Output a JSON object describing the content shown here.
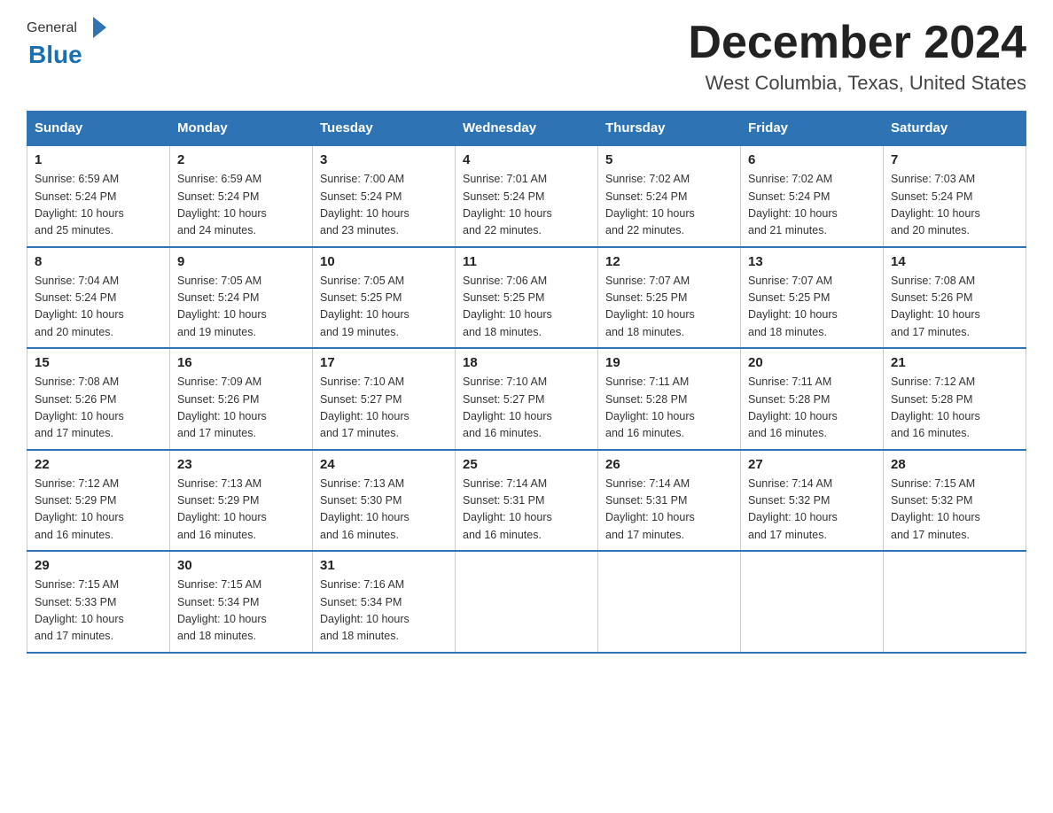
{
  "logo": {
    "general": "General",
    "blue": "Blue"
  },
  "title": "December 2024",
  "location": "West Columbia, Texas, United States",
  "weekdays": [
    "Sunday",
    "Monday",
    "Tuesday",
    "Wednesday",
    "Thursday",
    "Friday",
    "Saturday"
  ],
  "weeks": [
    [
      {
        "day": "1",
        "sunrise": "6:59 AM",
        "sunset": "5:24 PM",
        "daylight": "10 hours and 25 minutes."
      },
      {
        "day": "2",
        "sunrise": "6:59 AM",
        "sunset": "5:24 PM",
        "daylight": "10 hours and 24 minutes."
      },
      {
        "day": "3",
        "sunrise": "7:00 AM",
        "sunset": "5:24 PM",
        "daylight": "10 hours and 23 minutes."
      },
      {
        "day": "4",
        "sunrise": "7:01 AM",
        "sunset": "5:24 PM",
        "daylight": "10 hours and 22 minutes."
      },
      {
        "day": "5",
        "sunrise": "7:02 AM",
        "sunset": "5:24 PM",
        "daylight": "10 hours and 22 minutes."
      },
      {
        "day": "6",
        "sunrise": "7:02 AM",
        "sunset": "5:24 PM",
        "daylight": "10 hours and 21 minutes."
      },
      {
        "day": "7",
        "sunrise": "7:03 AM",
        "sunset": "5:24 PM",
        "daylight": "10 hours and 20 minutes."
      }
    ],
    [
      {
        "day": "8",
        "sunrise": "7:04 AM",
        "sunset": "5:24 PM",
        "daylight": "10 hours and 20 minutes."
      },
      {
        "day": "9",
        "sunrise": "7:05 AM",
        "sunset": "5:24 PM",
        "daylight": "10 hours and 19 minutes."
      },
      {
        "day": "10",
        "sunrise": "7:05 AM",
        "sunset": "5:25 PM",
        "daylight": "10 hours and 19 minutes."
      },
      {
        "day": "11",
        "sunrise": "7:06 AM",
        "sunset": "5:25 PM",
        "daylight": "10 hours and 18 minutes."
      },
      {
        "day": "12",
        "sunrise": "7:07 AM",
        "sunset": "5:25 PM",
        "daylight": "10 hours and 18 minutes."
      },
      {
        "day": "13",
        "sunrise": "7:07 AM",
        "sunset": "5:25 PM",
        "daylight": "10 hours and 18 minutes."
      },
      {
        "day": "14",
        "sunrise": "7:08 AM",
        "sunset": "5:26 PM",
        "daylight": "10 hours and 17 minutes."
      }
    ],
    [
      {
        "day": "15",
        "sunrise": "7:08 AM",
        "sunset": "5:26 PM",
        "daylight": "10 hours and 17 minutes."
      },
      {
        "day": "16",
        "sunrise": "7:09 AM",
        "sunset": "5:26 PM",
        "daylight": "10 hours and 17 minutes."
      },
      {
        "day": "17",
        "sunrise": "7:10 AM",
        "sunset": "5:27 PM",
        "daylight": "10 hours and 17 minutes."
      },
      {
        "day": "18",
        "sunrise": "7:10 AM",
        "sunset": "5:27 PM",
        "daylight": "10 hours and 16 minutes."
      },
      {
        "day": "19",
        "sunrise": "7:11 AM",
        "sunset": "5:28 PM",
        "daylight": "10 hours and 16 minutes."
      },
      {
        "day": "20",
        "sunrise": "7:11 AM",
        "sunset": "5:28 PM",
        "daylight": "10 hours and 16 minutes."
      },
      {
        "day": "21",
        "sunrise": "7:12 AM",
        "sunset": "5:28 PM",
        "daylight": "10 hours and 16 minutes."
      }
    ],
    [
      {
        "day": "22",
        "sunrise": "7:12 AM",
        "sunset": "5:29 PM",
        "daylight": "10 hours and 16 minutes."
      },
      {
        "day": "23",
        "sunrise": "7:13 AM",
        "sunset": "5:29 PM",
        "daylight": "10 hours and 16 minutes."
      },
      {
        "day": "24",
        "sunrise": "7:13 AM",
        "sunset": "5:30 PM",
        "daylight": "10 hours and 16 minutes."
      },
      {
        "day": "25",
        "sunrise": "7:14 AM",
        "sunset": "5:31 PM",
        "daylight": "10 hours and 16 minutes."
      },
      {
        "day": "26",
        "sunrise": "7:14 AM",
        "sunset": "5:31 PM",
        "daylight": "10 hours and 17 minutes."
      },
      {
        "day": "27",
        "sunrise": "7:14 AM",
        "sunset": "5:32 PM",
        "daylight": "10 hours and 17 minutes."
      },
      {
        "day": "28",
        "sunrise": "7:15 AM",
        "sunset": "5:32 PM",
        "daylight": "10 hours and 17 minutes."
      }
    ],
    [
      {
        "day": "29",
        "sunrise": "7:15 AM",
        "sunset": "5:33 PM",
        "daylight": "10 hours and 17 minutes."
      },
      {
        "day": "30",
        "sunrise": "7:15 AM",
        "sunset": "5:34 PM",
        "daylight": "10 hours and 18 minutes."
      },
      {
        "day": "31",
        "sunrise": "7:16 AM",
        "sunset": "5:34 PM",
        "daylight": "10 hours and 18 minutes."
      },
      null,
      null,
      null,
      null
    ]
  ],
  "labels": {
    "sunrise": "Sunrise:",
    "sunset": "Sunset:",
    "daylight": "Daylight:"
  }
}
